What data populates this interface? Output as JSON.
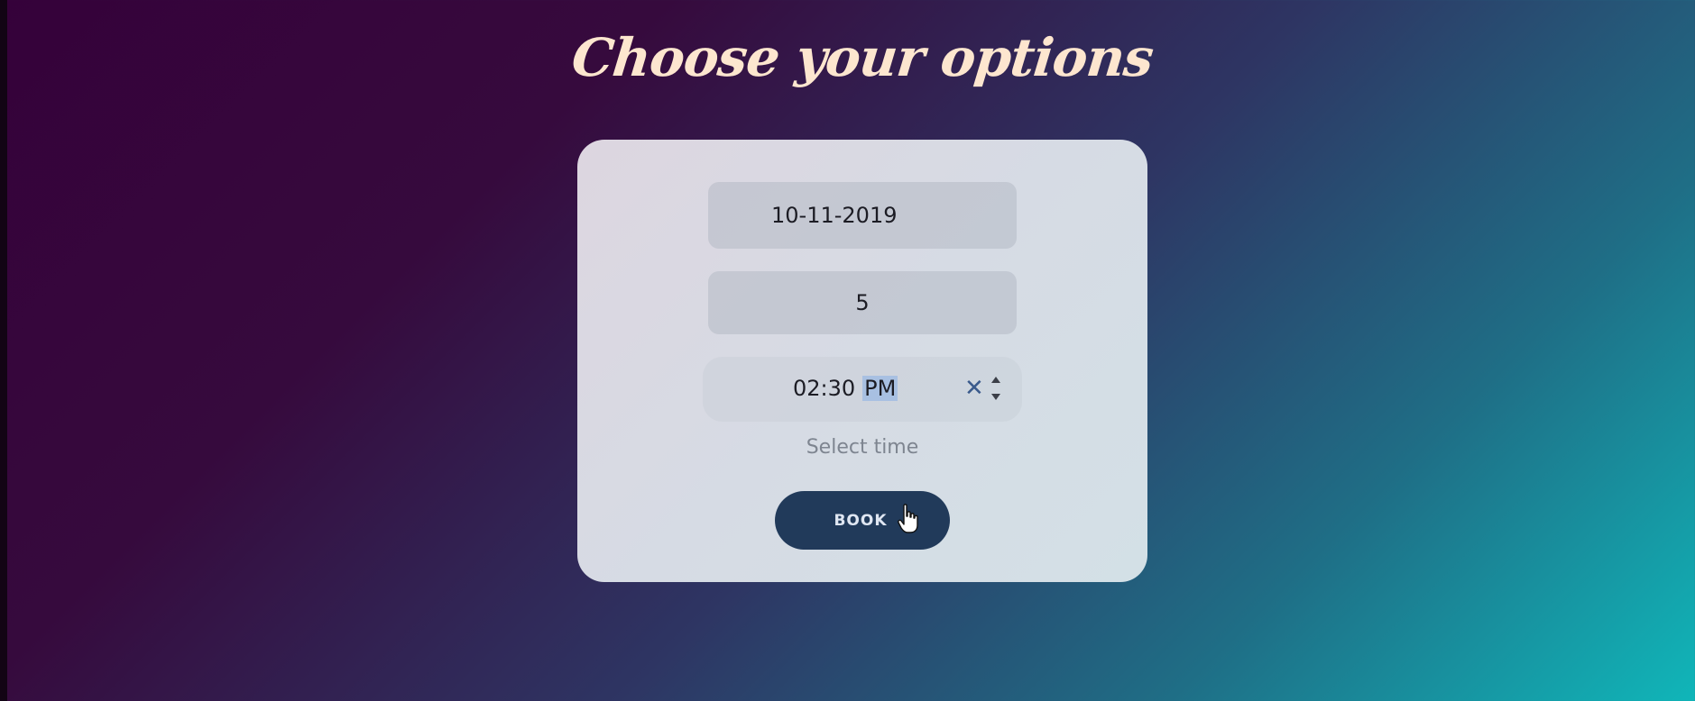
{
  "page": {
    "title": "Choose your options"
  },
  "form": {
    "date_value": "10-11-2019",
    "number_value": "5",
    "time_hours_minutes": "02:30",
    "time_period": "PM",
    "time_caption": "Select time",
    "clear_icon": "close-icon",
    "spinner_icon": "spinner-arrows-icon",
    "book_label": "BOOK"
  },
  "colors": {
    "title": "#fde6cf",
    "button_bg": "#213a5a",
    "selection_highlight": "#a8c0e2",
    "gradient_start": "#35013a",
    "gradient_end": "#10b6b9"
  }
}
